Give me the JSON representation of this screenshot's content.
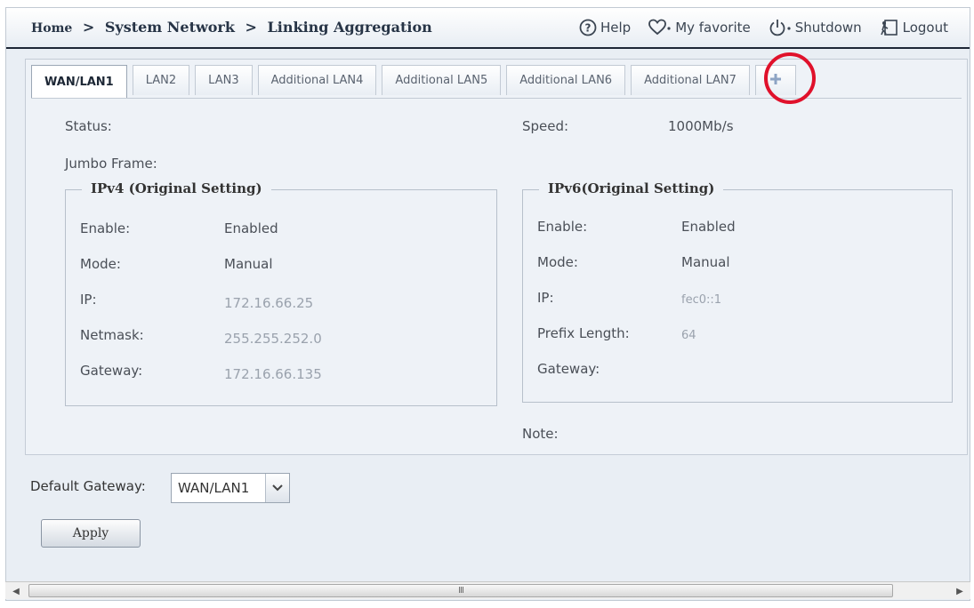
{
  "breadcrumb": {
    "home": "Home",
    "section": "System Network",
    "page": "Linking Aggregation",
    "separator": ">"
  },
  "toplinks": {
    "help": "Help",
    "favorite": "My favorite",
    "shutdown": "Shutdown",
    "logout": "Logout"
  },
  "tabs": [
    {
      "label": "WAN/LAN1",
      "active": true
    },
    {
      "label": "LAN2"
    },
    {
      "label": "LAN3"
    },
    {
      "label": "Additional LAN4"
    },
    {
      "label": "Additional LAN5"
    },
    {
      "label": "Additional LAN6"
    },
    {
      "label": "Additional LAN7"
    }
  ],
  "add_tab_glyph": "+",
  "status": {
    "label": "Status:",
    "value": ""
  },
  "speed": {
    "label": "Speed:",
    "value": "1000Mb/s"
  },
  "jumbo": {
    "label": "Jumbo Frame:",
    "value": ""
  },
  "note": {
    "label": "Note:"
  },
  "ipv4": {
    "legend": "IPv4 (Original Setting)",
    "enable_label": "Enable:",
    "enable_value": "Enabled",
    "mode_label": "Mode:",
    "mode_value": "Manual",
    "ip_label": "IP:",
    "ip_value": "172.16.66.25",
    "netmask_label": "Netmask:",
    "netmask_value": "255.255.252.0",
    "gateway_label": "Gateway:",
    "gateway_value": "172.16.66.135"
  },
  "ipv6": {
    "legend": "IPv6(Original Setting)",
    "enable_label": "Enable:",
    "enable_value": "Enabled",
    "mode_label": "Mode:",
    "mode_value": "Manual",
    "ip_label": "IP:",
    "ip_value": "fec0::1",
    "prefix_label": "Prefix Length:",
    "prefix_value": "64",
    "gateway_label": "Gateway:",
    "gateway_value": ""
  },
  "default_gateway": {
    "label": "Default Gateway:",
    "selected": "WAN/LAN1"
  },
  "apply_label": "Apply",
  "scrollbar_grip": "III",
  "colors": {
    "highlight_circle": "#e0112b",
    "topbar_border": "#1d2735"
  }
}
